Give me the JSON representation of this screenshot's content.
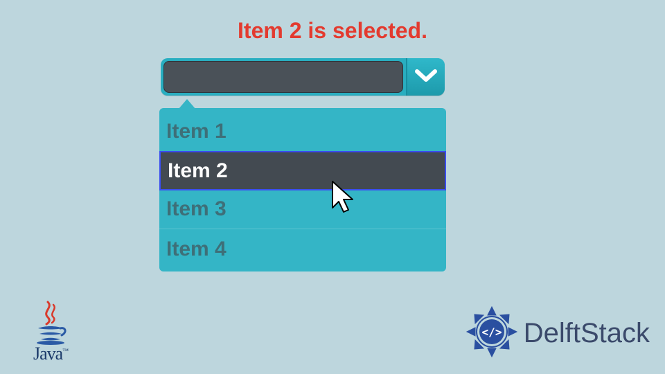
{
  "title": "Item 2 is selected.",
  "combo": {
    "selected_value": "",
    "dropdown_icon": "chevron-down"
  },
  "menu": {
    "items": [
      {
        "label": "Item 1",
        "selected": false
      },
      {
        "label": "Item 2",
        "selected": true
      },
      {
        "label": "Item 3",
        "selected": false
      },
      {
        "label": "Item 4",
        "selected": false
      }
    ]
  },
  "logos": {
    "java": "Java",
    "delftstack": "DelftStack"
  }
}
